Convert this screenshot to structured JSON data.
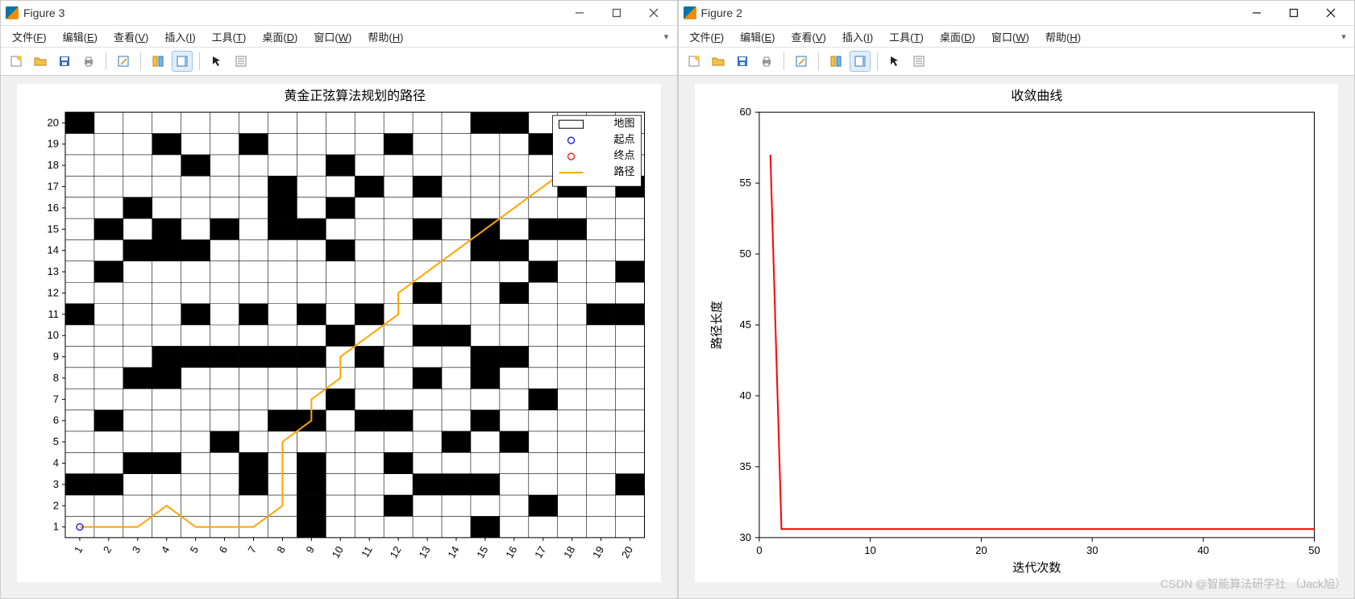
{
  "watermark": "CSDN @智能算法研学社 （Jack旭）",
  "windows": [
    {
      "id": "fig3",
      "title": "Figure 3",
      "menus": [
        "文件(F)",
        "编辑(E)",
        "查看(V)",
        "插入(I)",
        "工具(T)",
        "桌面(D)",
        "窗口(W)",
        "帮助(H)"
      ]
    },
    {
      "id": "fig2",
      "title": "Figure 2",
      "menus": [
        "文件(F)",
        "编辑(E)",
        "查看(V)",
        "插入(I)",
        "工具(T)",
        "桌面(D)",
        "窗口(W)",
        "帮助(H)"
      ]
    }
  ],
  "chart_data": [
    {
      "id": "fig3",
      "type": "grid_map_with_path",
      "title": "黄金正弦算法规划的路径",
      "xlabel": "",
      "ylabel": "",
      "xlim": [
        1,
        20
      ],
      "ylim": [
        1,
        20
      ],
      "xticks": [
        1,
        2,
        3,
        4,
        5,
        6,
        7,
        8,
        9,
        10,
        11,
        12,
        13,
        14,
        15,
        16,
        17,
        18,
        19,
        20
      ],
      "yticks": [
        1,
        2,
        3,
        4,
        5,
        6,
        7,
        8,
        9,
        10,
        11,
        12,
        13,
        14,
        15,
        16,
        17,
        18,
        19,
        20
      ],
      "grid": true,
      "legend": {
        "position": "top-right",
        "items": [
          {
            "label": "地图",
            "marker": "square-outline",
            "color": "#000"
          },
          {
            "label": "起点",
            "marker": "circle-outline",
            "color": "#0000ff"
          },
          {
            "label": "终点",
            "marker": "circle-outline",
            "color": "#ff0000"
          },
          {
            "label": "路径",
            "marker": "line",
            "color": "#ffa500"
          }
        ]
      },
      "start": [
        1,
        1
      ],
      "end": [
        20,
        20
      ],
      "obstacles": [
        [
          1,
          3
        ],
        [
          1,
          11
        ],
        [
          1,
          20
        ],
        [
          2,
          3
        ],
        [
          2,
          6
        ],
        [
          2,
          13
        ],
        [
          2,
          15
        ],
        [
          3,
          4
        ],
        [
          3,
          8
        ],
        [
          3,
          14
        ],
        [
          3,
          16
        ],
        [
          4,
          4
        ],
        [
          4,
          8
        ],
        [
          4,
          9
        ],
        [
          4,
          14
        ],
        [
          4,
          15
        ],
        [
          4,
          19
        ],
        [
          5,
          9
        ],
        [
          5,
          11
        ],
        [
          5,
          14
        ],
        [
          5,
          18
        ],
        [
          6,
          5
        ],
        [
          6,
          9
        ],
        [
          6,
          15
        ],
        [
          7,
          3
        ],
        [
          7,
          4
        ],
        [
          7,
          9
        ],
        [
          7,
          11
        ],
        [
          7,
          19
        ],
        [
          8,
          6
        ],
        [
          8,
          9
        ],
        [
          8,
          15
        ],
        [
          8,
          16
        ],
        [
          8,
          17
        ],
        [
          9,
          1
        ],
        [
          9,
          2
        ],
        [
          9,
          3
        ],
        [
          9,
          4
        ],
        [
          9,
          6
        ],
        [
          9,
          9
        ],
        [
          9,
          11
        ],
        [
          9,
          15
        ],
        [
          10,
          7
        ],
        [
          10,
          10
        ],
        [
          10,
          14
        ],
        [
          10,
          16
        ],
        [
          10,
          18
        ],
        [
          11,
          6
        ],
        [
          11,
          9
        ],
        [
          11,
          11
        ],
        [
          11,
          17
        ],
        [
          12,
          2
        ],
        [
          12,
          4
        ],
        [
          12,
          6
        ],
        [
          12,
          19
        ],
        [
          13,
          3
        ],
        [
          13,
          8
        ],
        [
          13,
          10
        ],
        [
          13,
          12
        ],
        [
          13,
          15
        ],
        [
          13,
          17
        ],
        [
          14,
          3
        ],
        [
          14,
          5
        ],
        [
          14,
          10
        ],
        [
          15,
          1
        ],
        [
          15,
          3
        ],
        [
          15,
          6
        ],
        [
          15,
          8
        ],
        [
          15,
          9
        ],
        [
          15,
          14
        ],
        [
          15,
          15
        ],
        [
          15,
          20
        ],
        [
          16,
          5
        ],
        [
          16,
          9
        ],
        [
          16,
          12
        ],
        [
          16,
          14
        ],
        [
          16,
          20
        ],
        [
          17,
          2
        ],
        [
          17,
          7
        ],
        [
          17,
          13
        ],
        [
          17,
          15
        ],
        [
          17,
          19
        ],
        [
          18,
          15
        ],
        [
          18,
          17
        ],
        [
          19,
          11
        ],
        [
          19,
          19
        ],
        [
          20,
          3
        ],
        [
          20,
          11
        ],
        [
          20,
          13
        ],
        [
          20,
          17
        ]
      ],
      "path": [
        [
          1,
          1
        ],
        [
          2,
          1
        ],
        [
          3,
          1
        ],
        [
          4,
          2
        ],
        [
          5,
          1
        ],
        [
          6,
          1
        ],
        [
          7,
          1
        ],
        [
          8,
          2
        ],
        [
          8,
          3
        ],
        [
          8,
          4
        ],
        [
          8,
          5
        ],
        [
          9,
          6
        ],
        [
          9,
          7
        ],
        [
          10,
          8
        ],
        [
          10,
          9
        ],
        [
          11,
          10
        ],
        [
          12,
          11
        ],
        [
          12,
          12
        ],
        [
          13,
          13
        ],
        [
          14,
          14
        ],
        [
          15,
          15
        ],
        [
          16,
          16
        ],
        [
          17,
          17
        ],
        [
          18,
          18
        ],
        [
          19,
          19
        ],
        [
          20,
          20
        ]
      ]
    },
    {
      "id": "fig2",
      "type": "line",
      "title": "收敛曲线",
      "xlabel": "迭代次数",
      "ylabel": "路径长度",
      "xlim": [
        0,
        50
      ],
      "ylim": [
        30,
        60
      ],
      "xticks": [
        0,
        10,
        20,
        30,
        40,
        50
      ],
      "yticks": [
        30,
        35,
        40,
        45,
        50,
        55,
        60
      ],
      "series": [
        {
          "name": "",
          "color": "#ff0000",
          "x": [
            1,
            2,
            3,
            4,
            5,
            10,
            15,
            20,
            25,
            30,
            35,
            40,
            45,
            50
          ],
          "y": [
            57,
            30.6,
            30.6,
            30.6,
            30.6,
            30.6,
            30.6,
            30.6,
            30.6,
            30.6,
            30.6,
            30.6,
            30.6,
            30.6
          ]
        }
      ]
    }
  ]
}
